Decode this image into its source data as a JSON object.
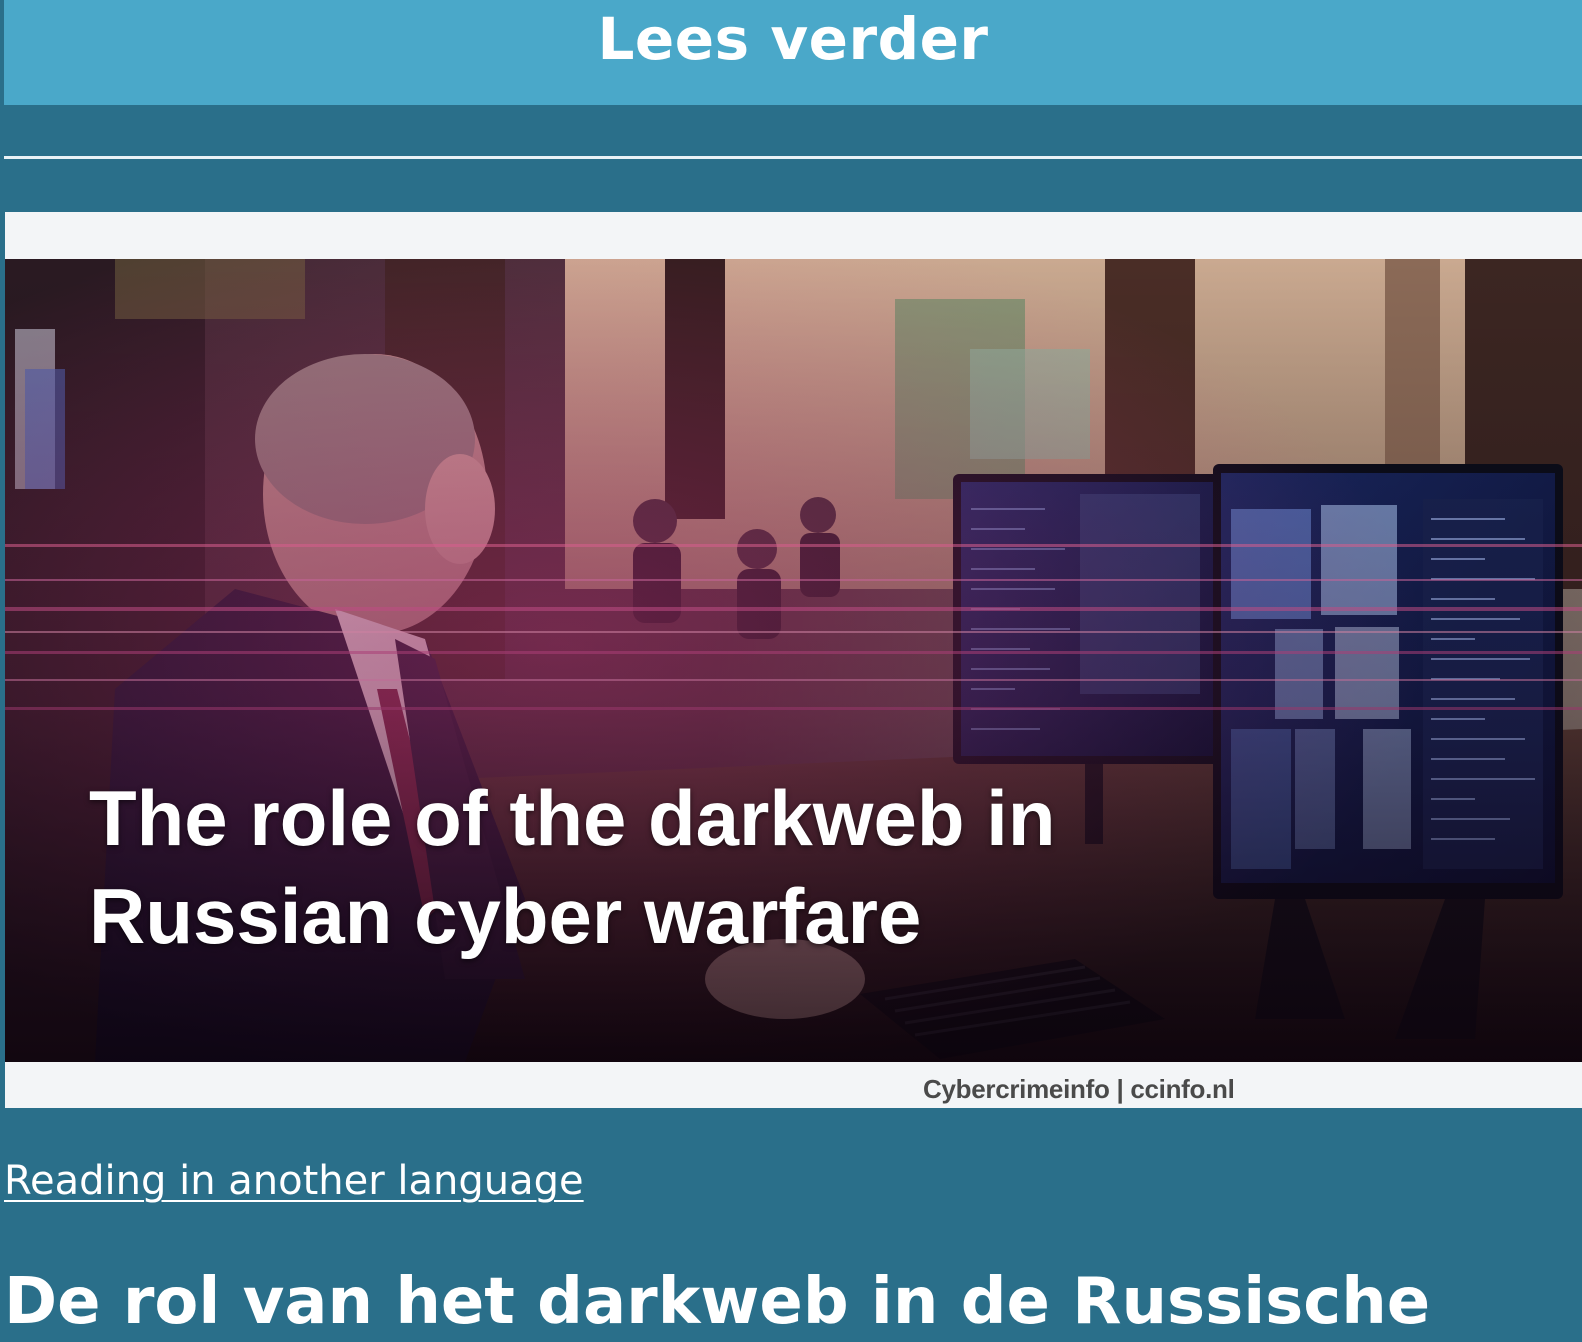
{
  "header": {
    "button_label": "Lees verder"
  },
  "hero": {
    "title_line1": "The role of the darkweb in",
    "title_line2": "Russian cyber warfare",
    "credit": "Cybercrimeinfo | ccinfo.nl"
  },
  "links": {
    "other_language": "Reading in another language"
  },
  "article": {
    "title": "De rol van het darkweb in de Russische"
  },
  "colors": {
    "page_background": "#2a6f8a",
    "button_background": "#4aa8c9",
    "text": "#ffffff"
  }
}
